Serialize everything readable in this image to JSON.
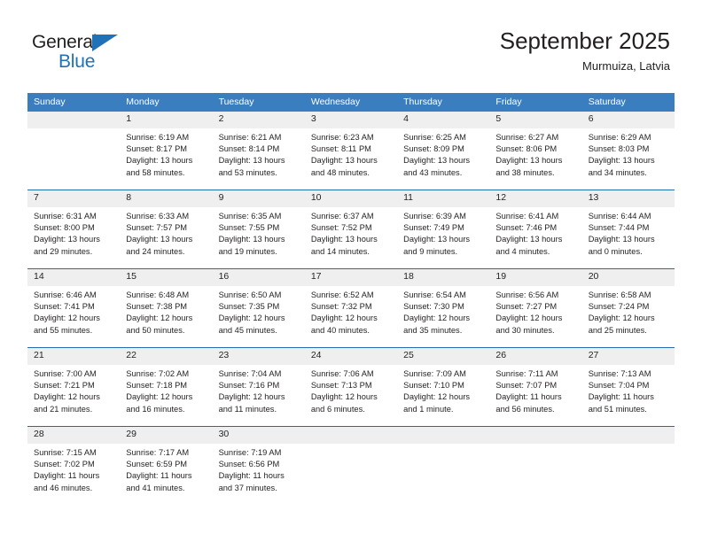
{
  "brand": {
    "name_part1": "General",
    "name_part2": "Blue",
    "accent_color": "#1f72b8"
  },
  "header": {
    "title": "September 2025",
    "subtitle": "Murmuiza, Latvia"
  },
  "theme": {
    "header_row_color": "#3b7ebf",
    "week_separator_color": "#1f6cb0",
    "daynum_band_color": "#efefef",
    "text_color": "#231f20"
  },
  "calendar": {
    "weekday_headers": [
      "Sunday",
      "Monday",
      "Tuesday",
      "Wednesday",
      "Thursday",
      "Friday",
      "Saturday"
    ],
    "weeks": [
      [
        {
          "day": "",
          "sunrise": "",
          "sunset": "",
          "daylight_line1": "",
          "daylight_line2": ""
        },
        {
          "day": "1",
          "sunrise": "Sunrise: 6:19 AM",
          "sunset": "Sunset: 8:17 PM",
          "daylight_line1": "Daylight: 13 hours",
          "daylight_line2": "and 58 minutes."
        },
        {
          "day": "2",
          "sunrise": "Sunrise: 6:21 AM",
          "sunset": "Sunset: 8:14 PM",
          "daylight_line1": "Daylight: 13 hours",
          "daylight_line2": "and 53 minutes."
        },
        {
          "day": "3",
          "sunrise": "Sunrise: 6:23 AM",
          "sunset": "Sunset: 8:11 PM",
          "daylight_line1": "Daylight: 13 hours",
          "daylight_line2": "and 48 minutes."
        },
        {
          "day": "4",
          "sunrise": "Sunrise: 6:25 AM",
          "sunset": "Sunset: 8:09 PM",
          "daylight_line1": "Daylight: 13 hours",
          "daylight_line2": "and 43 minutes."
        },
        {
          "day": "5",
          "sunrise": "Sunrise: 6:27 AM",
          "sunset": "Sunset: 8:06 PM",
          "daylight_line1": "Daylight: 13 hours",
          "daylight_line2": "and 38 minutes."
        },
        {
          "day": "6",
          "sunrise": "Sunrise: 6:29 AM",
          "sunset": "Sunset: 8:03 PM",
          "daylight_line1": "Daylight: 13 hours",
          "daylight_line2": "and 34 minutes."
        }
      ],
      [
        {
          "day": "7",
          "sunrise": "Sunrise: 6:31 AM",
          "sunset": "Sunset: 8:00 PM",
          "daylight_line1": "Daylight: 13 hours",
          "daylight_line2": "and 29 minutes."
        },
        {
          "day": "8",
          "sunrise": "Sunrise: 6:33 AM",
          "sunset": "Sunset: 7:57 PM",
          "daylight_line1": "Daylight: 13 hours",
          "daylight_line2": "and 24 minutes."
        },
        {
          "day": "9",
          "sunrise": "Sunrise: 6:35 AM",
          "sunset": "Sunset: 7:55 PM",
          "daylight_line1": "Daylight: 13 hours",
          "daylight_line2": "and 19 minutes."
        },
        {
          "day": "10",
          "sunrise": "Sunrise: 6:37 AM",
          "sunset": "Sunset: 7:52 PM",
          "daylight_line1": "Daylight: 13 hours",
          "daylight_line2": "and 14 minutes."
        },
        {
          "day": "11",
          "sunrise": "Sunrise: 6:39 AM",
          "sunset": "Sunset: 7:49 PM",
          "daylight_line1": "Daylight: 13 hours",
          "daylight_line2": "and 9 minutes."
        },
        {
          "day": "12",
          "sunrise": "Sunrise: 6:41 AM",
          "sunset": "Sunset: 7:46 PM",
          "daylight_line1": "Daylight: 13 hours",
          "daylight_line2": "and 4 minutes."
        },
        {
          "day": "13",
          "sunrise": "Sunrise: 6:44 AM",
          "sunset": "Sunset: 7:44 PM",
          "daylight_line1": "Daylight: 13 hours",
          "daylight_line2": "and 0 minutes."
        }
      ],
      [
        {
          "day": "14",
          "sunrise": "Sunrise: 6:46 AM",
          "sunset": "Sunset: 7:41 PM",
          "daylight_line1": "Daylight: 12 hours",
          "daylight_line2": "and 55 minutes."
        },
        {
          "day": "15",
          "sunrise": "Sunrise: 6:48 AM",
          "sunset": "Sunset: 7:38 PM",
          "daylight_line1": "Daylight: 12 hours",
          "daylight_line2": "and 50 minutes."
        },
        {
          "day": "16",
          "sunrise": "Sunrise: 6:50 AM",
          "sunset": "Sunset: 7:35 PM",
          "daylight_line1": "Daylight: 12 hours",
          "daylight_line2": "and 45 minutes."
        },
        {
          "day": "17",
          "sunrise": "Sunrise: 6:52 AM",
          "sunset": "Sunset: 7:32 PM",
          "daylight_line1": "Daylight: 12 hours",
          "daylight_line2": "and 40 minutes."
        },
        {
          "day": "18",
          "sunrise": "Sunrise: 6:54 AM",
          "sunset": "Sunset: 7:30 PM",
          "daylight_line1": "Daylight: 12 hours",
          "daylight_line2": "and 35 minutes."
        },
        {
          "day": "19",
          "sunrise": "Sunrise: 6:56 AM",
          "sunset": "Sunset: 7:27 PM",
          "daylight_line1": "Daylight: 12 hours",
          "daylight_line2": "and 30 minutes."
        },
        {
          "day": "20",
          "sunrise": "Sunrise: 6:58 AM",
          "sunset": "Sunset: 7:24 PM",
          "daylight_line1": "Daylight: 12 hours",
          "daylight_line2": "and 25 minutes."
        }
      ],
      [
        {
          "day": "21",
          "sunrise": "Sunrise: 7:00 AM",
          "sunset": "Sunset: 7:21 PM",
          "daylight_line1": "Daylight: 12 hours",
          "daylight_line2": "and 21 minutes."
        },
        {
          "day": "22",
          "sunrise": "Sunrise: 7:02 AM",
          "sunset": "Sunset: 7:18 PM",
          "daylight_line1": "Daylight: 12 hours",
          "daylight_line2": "and 16 minutes."
        },
        {
          "day": "23",
          "sunrise": "Sunrise: 7:04 AM",
          "sunset": "Sunset: 7:16 PM",
          "daylight_line1": "Daylight: 12 hours",
          "daylight_line2": "and 11 minutes."
        },
        {
          "day": "24",
          "sunrise": "Sunrise: 7:06 AM",
          "sunset": "Sunset: 7:13 PM",
          "daylight_line1": "Daylight: 12 hours",
          "daylight_line2": "and 6 minutes."
        },
        {
          "day": "25",
          "sunrise": "Sunrise: 7:09 AM",
          "sunset": "Sunset: 7:10 PM",
          "daylight_line1": "Daylight: 12 hours",
          "daylight_line2": "and 1 minute."
        },
        {
          "day": "26",
          "sunrise": "Sunrise: 7:11 AM",
          "sunset": "Sunset: 7:07 PM",
          "daylight_line1": "Daylight: 11 hours",
          "daylight_line2": "and 56 minutes."
        },
        {
          "day": "27",
          "sunrise": "Sunrise: 7:13 AM",
          "sunset": "Sunset: 7:04 PM",
          "daylight_line1": "Daylight: 11 hours",
          "daylight_line2": "and 51 minutes."
        }
      ],
      [
        {
          "day": "28",
          "sunrise": "Sunrise: 7:15 AM",
          "sunset": "Sunset: 7:02 PM",
          "daylight_line1": "Daylight: 11 hours",
          "daylight_line2": "and 46 minutes."
        },
        {
          "day": "29",
          "sunrise": "Sunrise: 7:17 AM",
          "sunset": "Sunset: 6:59 PM",
          "daylight_line1": "Daylight: 11 hours",
          "daylight_line2": "and 41 minutes."
        },
        {
          "day": "30",
          "sunrise": "Sunrise: 7:19 AM",
          "sunset": "Sunset: 6:56 PM",
          "daylight_line1": "Daylight: 11 hours",
          "daylight_line2": "and 37 minutes."
        },
        {
          "day": "",
          "sunrise": "",
          "sunset": "",
          "daylight_line1": "",
          "daylight_line2": ""
        },
        {
          "day": "",
          "sunrise": "",
          "sunset": "",
          "daylight_line1": "",
          "daylight_line2": ""
        },
        {
          "day": "",
          "sunrise": "",
          "sunset": "",
          "daylight_line1": "",
          "daylight_line2": ""
        },
        {
          "day": "",
          "sunrise": "",
          "sunset": "",
          "daylight_line1": "",
          "daylight_line2": ""
        }
      ]
    ]
  }
}
